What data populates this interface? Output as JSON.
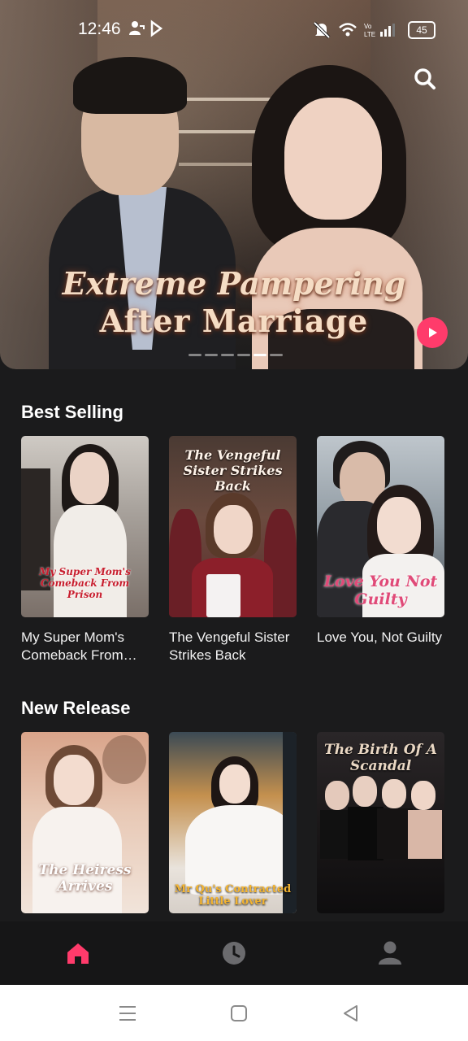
{
  "status_bar": {
    "time": "12:46",
    "battery": "45"
  },
  "hero": {
    "title_line1": "Extreme Pampering",
    "title_line2": "After Marriage",
    "active_dot": 4,
    "dot_count": 6
  },
  "sections": {
    "best_selling": {
      "title": "Best Selling",
      "items": [
        {
          "title": "My Super Mom's Comeback From Prison",
          "poster_text": "My Super Mom's Comeback From Prison"
        },
        {
          "title": "The Vengeful Sister Strikes Back",
          "poster_text": "The Vengeful Sister Strikes Back"
        },
        {
          "title": "Love You, Not Guilty",
          "poster_text": "Love You Not Guilty"
        }
      ]
    },
    "new_release": {
      "title": "New Release",
      "items": [
        {
          "poster_text": "The Heiress Arrives"
        },
        {
          "poster_text": "Mr Qu's Contracted Little Lover"
        },
        {
          "poster_text": "The Birth Of A Scandal"
        }
      ]
    }
  },
  "tab_bar": {
    "tabs": [
      {
        "icon": "home-icon",
        "active": true
      },
      {
        "icon": "clock-icon",
        "active": false
      },
      {
        "icon": "profile-icon",
        "active": false
      }
    ]
  },
  "colors": {
    "accent": "#ff3b6b",
    "background": "#1b1b1c",
    "tab_inactive": "#6b6b6e"
  }
}
